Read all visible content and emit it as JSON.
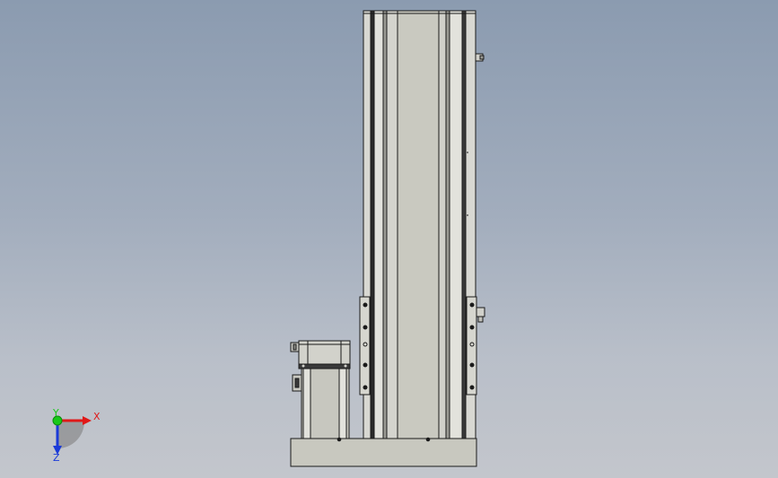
{
  "viewport": {
    "background_top": "#8b9bb0",
    "background_bottom": "#c3c6cc"
  },
  "model": {
    "body_color": "#c6c6bd",
    "rail_color": "#dcdcd6",
    "edge_color": "#1a1a1a",
    "accent_dark": "#2a2a2a"
  },
  "triad": {
    "x_label": "X",
    "y_label": "Y",
    "z_label": "Z",
    "x_color": "#e01818",
    "y_color": "#18c818",
    "z_color": "#1a3ad8",
    "icons": [
      "coordinate-triad-icon"
    ]
  }
}
